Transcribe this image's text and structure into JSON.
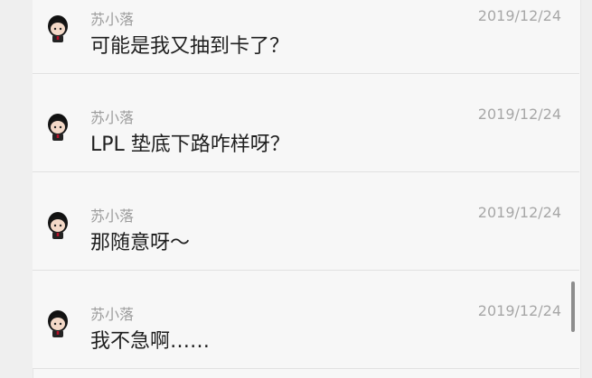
{
  "messages": [
    {
      "name": "苏小落",
      "date": "2019/12/24",
      "text": "可能是我又抽到卡了？",
      "avatar_icon": "chibi-boy-avatar-icon"
    },
    {
      "name": "苏小落",
      "date": "2019/12/24",
      "text": "LPL 垫底下路咋样呀？",
      "avatar_icon": "chibi-boy-avatar-icon"
    },
    {
      "name": "苏小落",
      "date": "2019/12/24",
      "text": "那随意呀～",
      "avatar_icon": "chibi-boy-avatar-icon"
    },
    {
      "name": "苏小落",
      "date": "2019/12/24",
      "text": "我不急啊……",
      "avatar_icon": "chibi-boy-avatar-icon"
    }
  ]
}
